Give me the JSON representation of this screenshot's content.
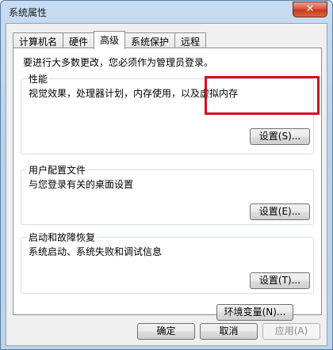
{
  "window": {
    "title": "系统属性",
    "close_label": "✕"
  },
  "tabs": [
    {
      "label": "计算机名",
      "active": false
    },
    {
      "label": "硬件",
      "active": false
    },
    {
      "label": "高级",
      "active": true
    },
    {
      "label": "系统保护",
      "active": false
    },
    {
      "label": "远程",
      "active": false
    }
  ],
  "advanced": {
    "notice": "要进行大多数更改，您必须作为管理员登录。",
    "performance": {
      "title": "性能",
      "description": "视觉效果，处理器计划，内存使用，以及虚拟内存",
      "button": "设置(S)..."
    },
    "user_profiles": {
      "title": "用户配置文件",
      "description": "与您登录有关的桌面设置",
      "button": "设置(E)..."
    },
    "startup_recovery": {
      "title": "启动和故障恢复",
      "description": "系统启动、系统失败和调试信息",
      "button": "设置(T)..."
    },
    "env_vars_button": "环境变量(N)..."
  },
  "footer": {
    "ok": "确定",
    "cancel": "取消",
    "apply": "应用(A)"
  },
  "colors": {
    "highlight": "#d0121b"
  }
}
